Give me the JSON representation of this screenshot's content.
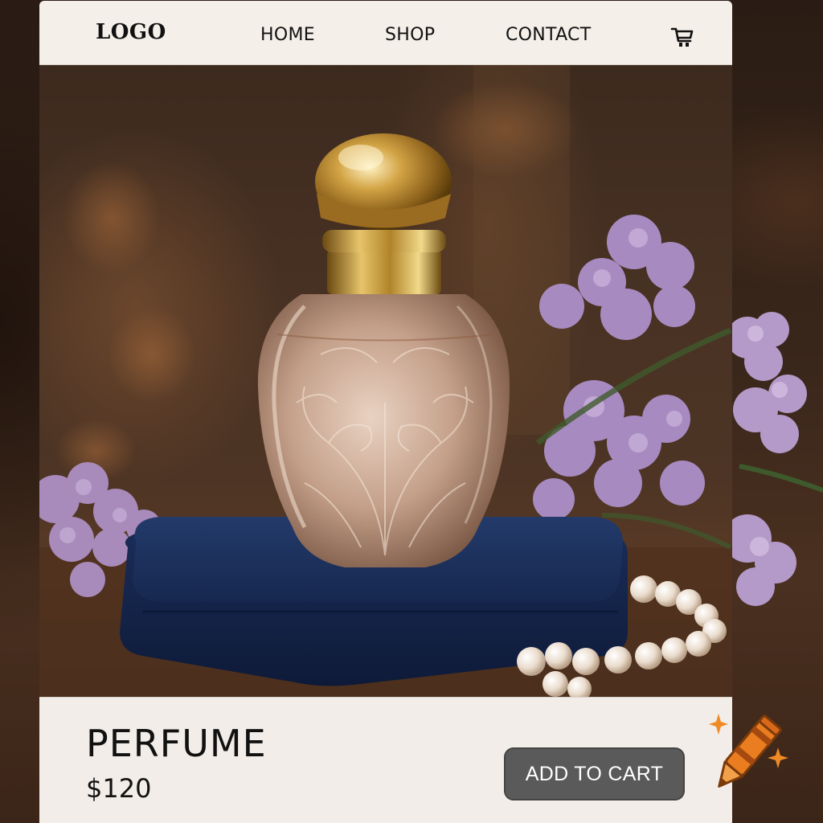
{
  "nav": {
    "logo": "LOGO",
    "links": [
      "HOME",
      "SHOP",
      "CONTACT"
    ],
    "cart_icon": "shopping-cart-icon"
  },
  "hero": {
    "image": "perfume bottle with gold cap on navy velvet box, lilac flowers and pearls"
  },
  "product": {
    "name": "PERFUME",
    "price": "$120",
    "add_to_cart_label": "ADD TO CART"
  },
  "decor": {
    "badge_icon": "crayon-sparkle-icon"
  },
  "colors": {
    "nav_bg": "#f4efe9",
    "product_bar_bg": "#f2ede8",
    "button_bg": "#5a5a5a",
    "button_text": "#ffffff",
    "text": "#111111"
  }
}
